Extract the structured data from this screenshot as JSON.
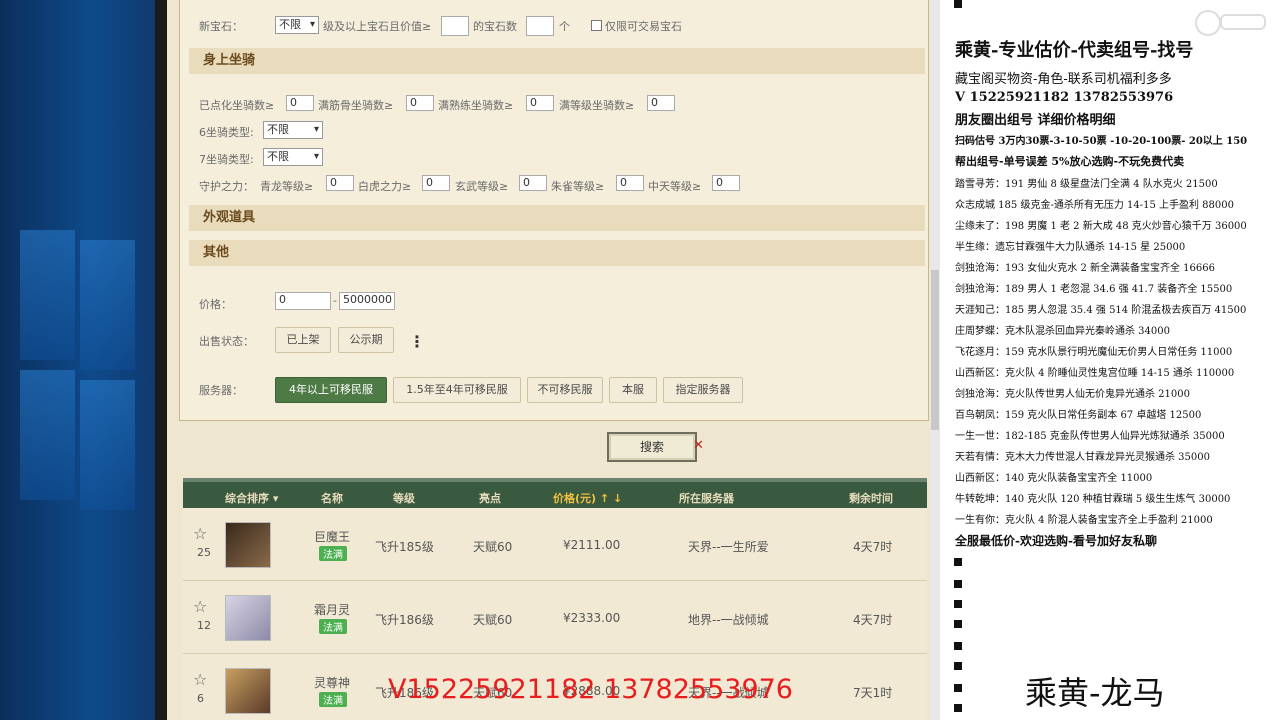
{
  "form": {
    "gem_label": "新宝石：",
    "gem_level_select": "不限",
    "gem_level_text": "级及以上宝石且价值≥",
    "gem_count_text": "的宝石数",
    "gem_unit": "个",
    "tradable_gem_label": "仅限可交易宝石",
    "section_mount": "身上坐骑",
    "mount_fields": [
      "已点化坐骑数≥",
      "满筋骨坐骑数≥",
      "满熟练坐骑数≥",
      "满等级坐骑数≥"
    ],
    "mount_values": [
      "0",
      "0",
      "0",
      "0"
    ],
    "mount6_label": "6坐骑类型:",
    "mount7_label": "7坐骑类型:",
    "mount_type_value": "不限",
    "guard_label": "守护之力：",
    "guard_fields": [
      "青龙等级≥",
      "白虎之力≥",
      "玄武等级≥",
      "朱雀等级≥",
      "中天等级≥"
    ],
    "guard_values": [
      "0",
      "0",
      "0",
      "0",
      "0"
    ],
    "section_appearance": "外观道具",
    "section_other": "其他",
    "price_label": "价格：",
    "price_min": "0",
    "price_sep": "-",
    "price_max": "5000000",
    "sale_status_label": "出售状态：",
    "sale_status_options": [
      "已上架",
      "公示期"
    ],
    "more_icon": "⋮",
    "server_label": "服务器：",
    "server_options": [
      "4年以上可移民服",
      "1.5年至4年可移民服",
      "不可移民服",
      "本服",
      "指定服务器"
    ],
    "search_button": "搜索"
  },
  "table": {
    "headers": [
      "综合排序",
      "名称",
      "等级",
      "亮点",
      "价格(元)",
      "所在服务器",
      "剩余时间"
    ],
    "rows": [
      {
        "count": "25",
        "name": "巨魔王",
        "tag": "法满",
        "level": "飞升185级",
        "highlight": "天赋60",
        "price": "¥2111.00",
        "server": "天界--一生所爱",
        "time": "4天7时"
      },
      {
        "count": "12",
        "name": "霜月灵",
        "tag": "法满",
        "level": "飞升186级",
        "highlight": "天赋60",
        "price": "¥2333.00",
        "server": "地界--一战倾城",
        "time": "4天7时"
      },
      {
        "count": "6",
        "name": "灵尊神",
        "tag": "法满",
        "level": "飞升186级",
        "highlight": "天赋60",
        "price": "¥2888.00",
        "server": "天界--一战倾城",
        "time": "7天1时"
      }
    ]
  },
  "overlay_text": "V15225921182  13782553976",
  "right_panel": {
    "title": "乘黄-专业估价-代卖组号-找号",
    "lines": [
      "藏宝阁买物资-角色-联系司机福利多多",
      "V 15225921182    13782553976",
      "朋友圈出组号    详细价格明细",
      "扫码估号 3万内30票-3-10-50票 -10-20-100票- 20以上 150",
      "帮出组号-单号误差 5%放心选购-不玩免费代卖",
      "踏雪寻芳：191 男仙 8 级星盘法门全满 4 队水克火 21500",
      "众志成城 185 级克金-通杀所有无压力 14-15 上手盈利 88000",
      "尘缘未了：198 男魔 1 老 2 新大成 48 克火炒音心猿千万 36000",
      "半生缘：遗忘甘霖强牛大力队通杀 14-15 星 25000",
      "剑独沧海：193 女仙火克水 2 新全满装备宝宝齐全 16666",
      "剑独沧海：189 男人 1 老忽混 34.6 强 41.7 装备齐全 15500",
      "天涯知己：185 男人忽混 35.4 强 514 阶混孟极去疾百万 41500",
      "庄周梦蝶：克木队混杀回血异光秦岭通杀 34000",
      "飞花逐月：159 克水队景行明光魔仙无价男人日常任务 11000",
      "山西新区：克火队 4 阶睡仙灵性鬼宫位睡 14-15 通杀 110000",
      "剑独沧海：克火队传世男人仙无价鬼异光通杀 21000",
      "百鸟朝凤：159 克火队日常任务副本 67 卓越塔 12500",
      "一生一世：182-185 克金队传世男人仙异光炼狱通杀 35000",
      "天若有情：克木大力传世混人甘霖龙异光灵猴通杀 35000",
      "山西新区：140 克火队装备宝宝齐全 11000",
      "牛转乾坤：140 克火队 120 种植甘霖瑞 5 级生生炼气 30000",
      "一生有你：克火队 4 阶混人装备宝宝齐全上手盈利 21000",
      "全服最低价-欢迎选购-看号加好友私聊"
    ],
    "signature": "乘黄-龙马"
  },
  "colors": {
    "accent_green": "#4d7a45",
    "table_header": "#3a5a3f",
    "overlay_red": "#e81d1d",
    "section_bg": "#e8dcbc"
  }
}
